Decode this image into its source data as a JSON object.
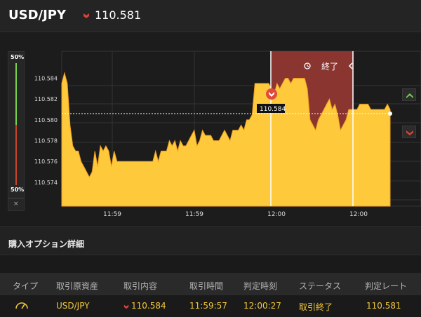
{
  "header": {
    "pair": "USD/JPY",
    "direction_icon": "down-arrow-icon",
    "rate": "110.581"
  },
  "gauge": {
    "top_label": "50%",
    "bottom_label": "50%",
    "close_label": "×",
    "up_share_percent": 50,
    "down_share_percent": 50
  },
  "chart": {
    "end_label": "終了",
    "entry_rate_label": "110.584",
    "y_ticks": [
      "110.584",
      "110.582",
      "110.580",
      "110.578",
      "110.576",
      "110.574"
    ],
    "x_ticks": [
      "11:59",
      "11:59",
      "12:00",
      "12:00"
    ],
    "colors": {
      "area": "#ffc93c",
      "expired": "#8a3530",
      "up": "#7ad14a",
      "down": "#d9443a"
    }
  },
  "chart_data": {
    "type": "area",
    "y_unit": "USD/JPY rate",
    "ylim": [
      110.5717,
      110.5866
    ],
    "reference_line": 110.581,
    "entry_value": 110.584,
    "values": [
      110.5835,
      110.5845,
      110.5835,
      110.5795,
      110.5775,
      110.577,
      110.577,
      110.576,
      110.5755,
      110.575,
      110.5745,
      110.575,
      110.577,
      110.5755,
      110.5775,
      110.577,
      110.5775,
      110.577,
      110.5755,
      110.577,
      110.576,
      110.576,
      110.576,
      110.576,
      110.576,
      110.576,
      110.576,
      110.576,
      110.576,
      110.576,
      110.576,
      110.576,
      110.576,
      110.576,
      110.577,
      110.576,
      110.577,
      110.577,
      110.577,
      110.578,
      110.5775,
      110.578,
      110.577,
      110.578,
      110.5775,
      110.5775,
      110.578,
      110.5785,
      110.579,
      110.5775,
      110.578,
      110.579,
      110.5785,
      110.5785,
      110.5785,
      110.578,
      110.578,
      110.578,
      110.5785,
      110.579,
      110.5785,
      110.578,
      110.579,
      110.579,
      110.579,
      110.5795,
      110.579,
      110.58,
      110.58,
      110.5805,
      110.5835,
      110.5835,
      110.5835,
      110.5835,
      110.5835,
      110.5835,
      110.583,
      110.5825,
      110.5835,
      110.583,
      110.5835,
      110.584,
      110.584,
      110.5835,
      110.584,
      110.584,
      110.584,
      110.584,
      110.584,
      110.583,
      110.58,
      110.5795,
      110.579,
      110.58,
      110.5805,
      110.581,
      110.5815,
      110.582,
      110.581,
      110.5815,
      110.5805,
      110.579,
      110.5795,
      110.58,
      110.581,
      110.581,
      110.581,
      110.581,
      110.5815,
      110.5815,
      110.5815,
      110.5815,
      110.581,
      110.581,
      110.581,
      110.581,
      110.581,
      110.581,
      110.5815,
      110.581
    ]
  },
  "purchase": {
    "title": "購入オプション詳細",
    "headers": [
      "タイプ",
      "取引原資産",
      "取引内容",
      "取引時間",
      "判定時刻",
      "ステータス",
      "判定レート"
    ],
    "row": {
      "type_icon": "gauge-icon",
      "asset": "USD/JPY",
      "direction_icon": "down-arrow-icon",
      "content": "110.584",
      "trade_time": "11:59:57",
      "judge_time": "12:00:27",
      "status": "取引終了",
      "judge_rate": "110.581"
    }
  }
}
